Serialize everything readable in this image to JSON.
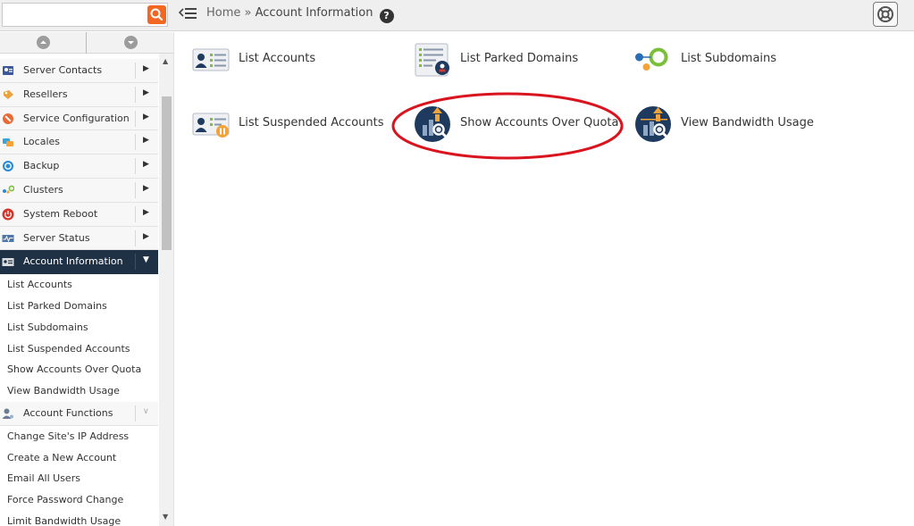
{
  "search": {
    "placeholder": "",
    "value": ""
  },
  "breadcrumb": {
    "home": "Home",
    "separator": " » ",
    "current": "Account Information",
    "help": "?"
  },
  "sidebar": {
    "nav_items": [
      {
        "label": "Server Contacts",
        "icon": "contacts-icon"
      },
      {
        "label": "Resellers",
        "icon": "resellers-icon"
      },
      {
        "label": "Service Configuration",
        "icon": "service-config-icon"
      },
      {
        "label": "Locales",
        "icon": "locales-icon"
      },
      {
        "label": "Backup",
        "icon": "backup-icon"
      },
      {
        "label": "Clusters",
        "icon": "clusters-icon"
      },
      {
        "label": "System Reboot",
        "icon": "power-icon"
      },
      {
        "label": "Server Status",
        "icon": "server-status-icon"
      },
      {
        "label": "Account Information",
        "icon": "account-info-icon",
        "active": true
      }
    ],
    "account_information_items": [
      "List Accounts",
      "List Parked Domains",
      "List Subdomains",
      "List Suspended Accounts",
      "Show Accounts Over Quota",
      "View Bandwidth Usage"
    ],
    "account_functions": {
      "label": "Account Functions",
      "icon": "account-functions-icon"
    },
    "account_functions_items": [
      "Change Site's IP Address",
      "Create a New Account",
      "Email All Users",
      "Force Password Change",
      "Limit Bandwidth Usage"
    ]
  },
  "main": {
    "tiles": [
      {
        "label": "List Accounts",
        "icon": "list-accounts-icon"
      },
      {
        "label": "List Parked Domains",
        "icon": "parked-domains-icon"
      },
      {
        "label": "List Subdomains",
        "icon": "subdomains-icon"
      },
      {
        "label": "List Suspended Accounts",
        "icon": "suspended-accounts-icon"
      },
      {
        "label": "Show Accounts Over Quota",
        "icon": "over-quota-icon",
        "highlighted": true
      },
      {
        "label": "View Bandwidth Usage",
        "icon": "bandwidth-icon"
      }
    ]
  },
  "colors": {
    "accent": "#f26722",
    "active_nav": "#1f3145",
    "highlight_ring": "#d9141e"
  }
}
